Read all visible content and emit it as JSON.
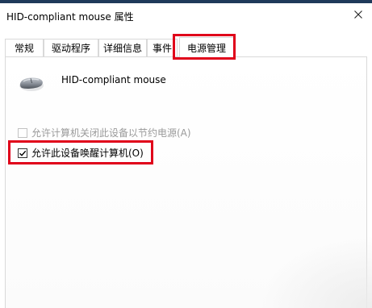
{
  "window": {
    "title": "HID-compliant mouse 属性"
  },
  "tabs": [
    {
      "label": "常规"
    },
    {
      "label": "驱动程序"
    },
    {
      "label": "详细信息"
    },
    {
      "label": "事件"
    },
    {
      "label": "电源管理"
    }
  ],
  "active_tab": "电源管理",
  "device": {
    "name": "HID-compliant mouse",
    "icon": "mouse-icon"
  },
  "options": [
    {
      "label": "允许计算机关闭此设备以节约电源(A)",
      "checked": false,
      "enabled": false
    },
    {
      "label": "允许此设备唤醒计算机(O)",
      "checked": true,
      "enabled": true
    }
  ],
  "highlight_color": "#e0001a"
}
